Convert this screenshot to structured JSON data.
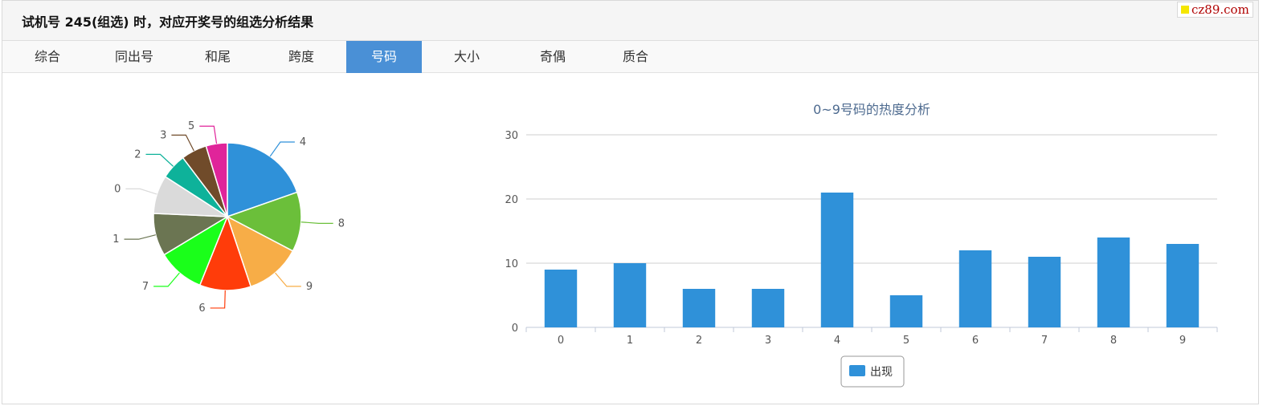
{
  "header": {
    "title": "试机号 245(组选) 时，对应开奖号的组选分析结果"
  },
  "watermark": {
    "text": "cz89.com"
  },
  "tabs": [
    {
      "label": "综合",
      "active": false
    },
    {
      "label": "同出号",
      "active": false
    },
    {
      "label": "和尾",
      "active": false
    },
    {
      "label": "跨度",
      "active": false
    },
    {
      "label": "号码",
      "active": true
    },
    {
      "label": "大小",
      "active": false
    },
    {
      "label": "奇偶",
      "active": false
    },
    {
      "label": "质合",
      "active": false
    }
  ],
  "chart_data": [
    {
      "type": "pie",
      "labels": [
        "4",
        "8",
        "9",
        "6",
        "7",
        "1",
        "0",
        "2",
        "3",
        "5"
      ],
      "values": [
        21,
        14,
        13,
        12,
        11,
        10,
        9,
        6,
        6,
        5
      ],
      "colors": [
        "#2f91d9",
        "#6bbf3a",
        "#f7ad47",
        "#ff3c0a",
        "#1aff1a",
        "#6b7552",
        "#dadada",
        "#0eb29a",
        "#704b2a",
        "#e0249a"
      ]
    },
    {
      "type": "bar",
      "title": "0~9号码的热度分析",
      "categories": [
        "0",
        "1",
        "2",
        "3",
        "4",
        "5",
        "6",
        "7",
        "8",
        "9"
      ],
      "series": [
        {
          "name": "出现",
          "values": [
            9,
            10,
            6,
            6,
            21,
            5,
            12,
            11,
            14,
            13
          ],
          "color": "#2f91d9"
        }
      ],
      "ylim": [
        0,
        30
      ],
      "yticks": [
        0,
        10,
        20,
        30
      ],
      "grid": true,
      "legend": "bottom"
    }
  ]
}
